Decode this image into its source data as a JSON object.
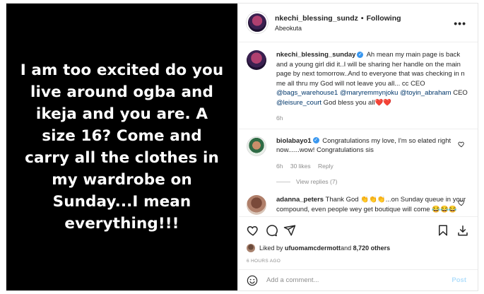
{
  "media": {
    "text": "I am too excited do you live around ogba and ikeja and you are. A size 16? Come and carry all the clothes in my wardrobe on Sunday...I mean everything!!!"
  },
  "header": {
    "username": "nkechi_blessing_sundz",
    "separator": "•",
    "follow_status": "Following",
    "location": "Abeokuta",
    "more": "•••"
  },
  "caption": {
    "username": "nkechi_blessing_sunday",
    "text_1": " Ah mean my main page is back and a young girl did it..I will be sharing her handle on the main page by next tomorrow..And to everyone that was checking in n me all thru my God will not leave you all... cc CEO ",
    "mention_1": "@bags_warehouse1",
    "mention_2": "@maryremmynjoku",
    "mention_3": "@toyin_abraham",
    "text_2": " CEO ",
    "mention_4": "@leisure_court",
    "text_3": " God bless you all",
    "hearts": "❤️❤️",
    "time": "6h"
  },
  "comments": [
    {
      "username": "biolabayo1",
      "text": " Congratulations my love, I'm so elated right now......wow! Congratulations sis",
      "time": "6h",
      "likes": "30 likes",
      "reply": "Reply",
      "view_replies": "View replies (7)"
    },
    {
      "username": "adanna_peters",
      "text": " Thank God 👏👏👏...on Sunday queue in your compound, even people wey get boutique will come 😂😂😂"
    }
  ],
  "likes": {
    "prefix": "Liked by ",
    "user": "ufuomamcdermott",
    "middle": " and ",
    "count": "8,720 others"
  },
  "timestamp": "6 HOURS AGO",
  "add_comment": {
    "placeholder": "Add a comment...",
    "post_label": "Post"
  }
}
